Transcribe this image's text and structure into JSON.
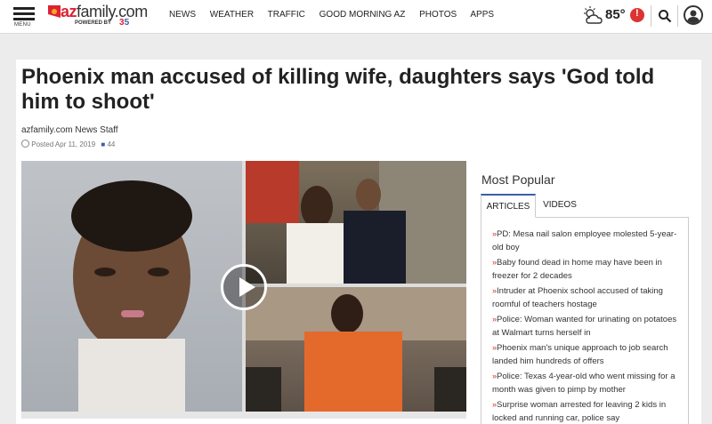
{
  "header": {
    "menu_label": "MENU",
    "logo_az": "az",
    "logo_family": "family.com",
    "powered_by": "POWERED BY",
    "channel": "3",
    "channel2": "5",
    "nav": [
      "NEWS",
      "WEATHER",
      "TRAFFIC",
      "GOOD MORNING AZ",
      "PHOTOS",
      "APPS"
    ],
    "weather_temp": "85°",
    "alert_symbol": "!"
  },
  "article": {
    "headline": "Phoenix man accused of killing wife, daughters says 'God told him to shoot'",
    "byline": "azfamily.com News Staff",
    "posted": "Posted Apr 11, 2019",
    "comments": "44"
  },
  "sidebar": {
    "title": "Most Popular",
    "tabs": [
      "ARTICLES",
      "VIDEOS"
    ],
    "items": [
      "PD: Mesa nail salon employee molested 5-year-old boy",
      "Baby found dead in home may have been in freezer for 2 decades",
      "Intruder at Phoenix school accused of taking roomful of teachers hostage",
      "Police: Woman wanted for urinating on potatoes at Walmart turns herself in",
      "Phoenix man's unique approach to job search landed him hundreds of offers",
      "Police: Texas 4-year-old who went missing for a month was given to pimp by mother",
      "Surprise woman arrested for leaving 2 kids in locked and running car, police say"
    ]
  },
  "colors": {
    "brand_red": "#dd2233",
    "tab_accent": "#3b5fa8",
    "alert_red": "#dd3333"
  }
}
